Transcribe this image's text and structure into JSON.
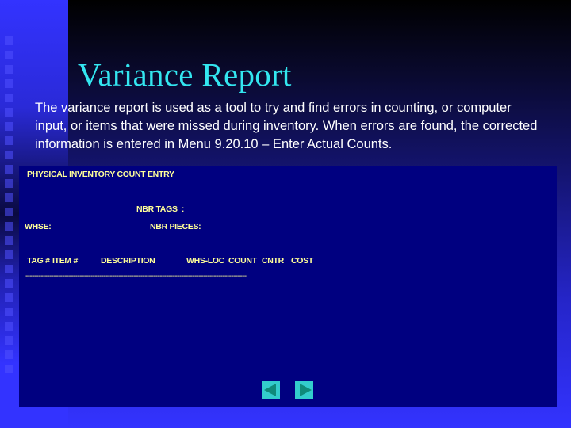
{
  "slide": {
    "title": "Variance Report",
    "intro": "The variance report is used as a tool to try and find errors in counting, or computer input, or items that were missed during inventory. When errors are found, the corrected information is entered in Menu 9.20.10 – Enter Actual Counts."
  },
  "screen": {
    "header": "PHYSICAL INVENTORY COUNT ENTRY",
    "nbr_tags_label": "NBR TAGS  :",
    "whse_label": "WHSE:",
    "nbr_pieces_label": "NBR PIECES:",
    "columns": {
      "tag": "TAG #",
      "item": "ITEM #",
      "description": "DESCRIPTION",
      "whs_loc": "WHS-LOC",
      "count": "COUNT",
      "cntr": "CNTR",
      "cost": "COST"
    },
    "separator": "------------------------------------------------------------------------------------------------------"
  },
  "navigation": {
    "prev_icon": "triangle-left-icon",
    "next_icon": "triangle-right-icon"
  },
  "colors": {
    "title": "#33e6f0",
    "panel": "#000080",
    "panel_text": "#ffff99",
    "nav_button": "#33cccc",
    "nav_arrow": "#0f8a7a"
  }
}
